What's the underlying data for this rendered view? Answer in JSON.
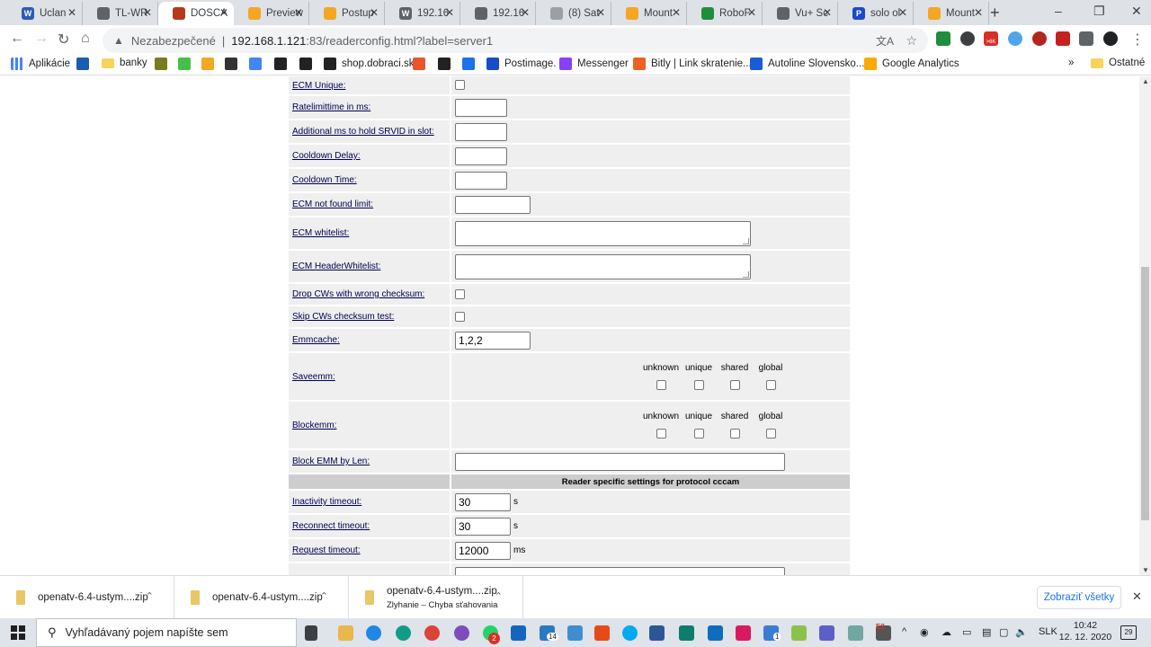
{
  "browser": {
    "tabs": [
      {
        "title": "Uclan",
        "color": "#2c5bb5",
        "glyph": "W"
      },
      {
        "title": "TL-WR",
        "color": "#5f6368",
        "glyph": ""
      },
      {
        "title": "DOSCA",
        "color": "#b33a1b",
        "glyph": "",
        "active": true
      },
      {
        "title": "Preview",
        "color": "#f5a623",
        "glyph": ""
      },
      {
        "title": "Postup",
        "color": "#f5a623",
        "glyph": ""
      },
      {
        "title": "192.16",
        "color": "#5f6368",
        "glyph": "W"
      },
      {
        "title": "192.16",
        "color": "#5f6368",
        "glyph": ""
      },
      {
        "title": "(8) Sat",
        "color": "#9aa0a6",
        "glyph": ""
      },
      {
        "title": "Mount",
        "color": "#f5a623",
        "glyph": ""
      },
      {
        "title": "RoboF",
        "color": "#1e8e3e",
        "glyph": ""
      },
      {
        "title": "Vu+ Sc",
        "color": "#5f6368",
        "glyph": ""
      },
      {
        "title": "solo ol",
        "color": "#1a4cc9",
        "glyph": "P"
      },
      {
        "title": "Mount",
        "color": "#f5a623",
        "glyph": ""
      }
    ],
    "new_tab": "+",
    "minimize": "–",
    "maximize": "❐",
    "close": "✕"
  },
  "omnibox": {
    "security": "Nezabezpečené",
    "separator": "|",
    "host": "192.168.1.121",
    "path": ":83/readerconfig.html?label=server1"
  },
  "bookmarks": [
    {
      "label": "Aplikácie",
      "kind": "apps"
    },
    {
      "label": "",
      "kind": "icon",
      "color": "#1a5cb0"
    },
    {
      "label": "banky",
      "kind": "folder"
    },
    {
      "label": "",
      "kind": "icon",
      "color": "#7a7a1e"
    },
    {
      "label": "",
      "kind": "icon",
      "color": "#46c04a"
    },
    {
      "label": "",
      "kind": "icon",
      "color": "#f5a623"
    },
    {
      "label": "",
      "kind": "icon",
      "color": "#333333"
    },
    {
      "label": "",
      "kind": "icon",
      "color": "#4285f4"
    },
    {
      "label": "",
      "kind": "icon",
      "color": "#222222"
    },
    {
      "label": "",
      "kind": "icon",
      "color": "#222222"
    },
    {
      "label": "shop.dobraci.sk",
      "kind": "icon",
      "color": "#222222"
    },
    {
      "label": "",
      "kind": "icon",
      "color": "#e8562a"
    },
    {
      "label": "",
      "kind": "icon",
      "color": "#222222"
    },
    {
      "label": "",
      "kind": "icon",
      "color": "#1a73e8"
    },
    {
      "label": "Postimage.",
      "kind": "icon",
      "color": "#1a4cc9"
    },
    {
      "label": "Messenger",
      "kind": "icon",
      "color": "#8a3ffc"
    },
    {
      "label": "Bitly | Link skratenie...",
      "kind": "icon",
      "color": "#ee6123"
    },
    {
      "label": "Autoline Slovensko...",
      "kind": "icon",
      "color": "#1a5cd8"
    },
    {
      "label": "Google Analytics",
      "kind": "icon",
      "color": "#f9ab00"
    }
  ],
  "bookmarks_more": "»",
  "bookmarks_other": "Ostatné",
  "form": {
    "rows": [
      {
        "label": "ECM Unique:",
        "type": "checkbox"
      },
      {
        "label": "Ratelimittime in ms:",
        "type": "text",
        "value": "",
        "width": 58
      },
      {
        "label": "Additional ms to hold SRVID in slot:",
        "type": "text",
        "value": "",
        "width": 58
      },
      {
        "label": "Cooldown Delay:",
        "type": "text",
        "value": "",
        "width": 58
      },
      {
        "label": "Cooldown Time:",
        "type": "text",
        "value": "",
        "width": 58
      },
      {
        "label": "ECM not found limit:",
        "type": "text",
        "value": "",
        "width": 84
      },
      {
        "label": "ECM whitelist:",
        "type": "textarea"
      },
      {
        "label": "ECM HeaderWhitelist:",
        "type": "textarea"
      },
      {
        "label": "Drop CWs with wrong checksum:",
        "type": "checkbox"
      },
      {
        "label": "Skip CWs checksum test:",
        "type": "checkbox"
      },
      {
        "label": "Emmcache:",
        "type": "text",
        "value": "1,2,2",
        "width": 84
      },
      {
        "label": "Saveemm:",
        "type": "emm"
      },
      {
        "label": "Blockemm:",
        "type": "emm"
      },
      {
        "label": "Block EMM by Len:",
        "type": "text",
        "value": "",
        "width": 367
      }
    ],
    "emm_headers": [
      "unknown",
      "unique",
      "shared",
      "global"
    ],
    "section_title": "Reader specific settings for protocol cccam",
    "cccam_rows": [
      {
        "label": "Inactivity timeout:",
        "value": "30",
        "unit": "s"
      },
      {
        "label": "Reconnect timeout:",
        "value": "30",
        "unit": "s"
      },
      {
        "label": "Request timeout:",
        "value": "12000",
        "unit": "ms"
      }
    ]
  },
  "downloads": [
    {
      "name": "openatv-6.4-ustym....zip",
      "status": ""
    },
    {
      "name": "openatv-6.4-ustym....zip",
      "status": ""
    },
    {
      "name": "openatv-6.4-ustym....zip",
      "status": "Zlyhanie – Chyba sťahovania"
    }
  ],
  "downloads_show_all": "Zobraziť všetky",
  "downloads_close": "✕",
  "taskbar": {
    "search_placeholder": "Vyhľadávaný pojem napíšte sem",
    "language": "SLK",
    "time": "10:42",
    "date": "12. 12. 2020",
    "notifications": "29",
    "badge_whatsapp": "2",
    "badge_14": "14",
    "badge_1": "1",
    "badge_e2": "E2",
    "badge_6k": ">6K"
  }
}
